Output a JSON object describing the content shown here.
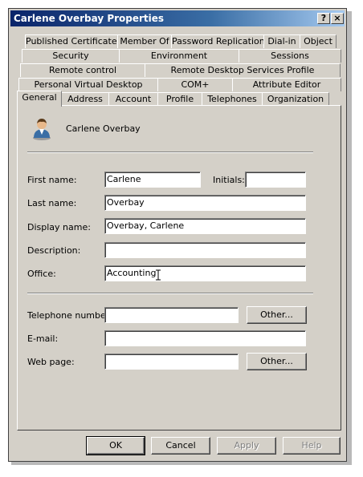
{
  "window": {
    "title": "Carlene Overbay Properties"
  },
  "titlebar": {
    "help_label": "?",
    "close_label": "×"
  },
  "tabs": {
    "row1": [
      "Published Certificates",
      "Member Of",
      "Password Replication",
      "Dial-in",
      "Object"
    ],
    "row2": [
      "Security",
      "Environment",
      "Sessions"
    ],
    "row3": [
      "Remote control",
      "Remote Desktop Services Profile"
    ],
    "row4": [
      "Personal Virtual Desktop",
      "COM+",
      "Attribute Editor"
    ],
    "row5": [
      "General",
      "Address",
      "Account",
      "Profile",
      "Telephones",
      "Organization"
    ]
  },
  "general": {
    "user_name": "Carlene Overbay",
    "first_name_label": "First name:",
    "first_name": "Carlene",
    "initials_label": "Initials:",
    "initials": "",
    "last_name_label": "Last name:",
    "last_name": "Overbay",
    "display_name_label": "Display name:",
    "display_name": "Overbay, Carlene",
    "description_label": "Description:",
    "description": "",
    "office_label": "Office:",
    "office": "Accounting",
    "telephone_label": "Telephone number:",
    "telephone": "",
    "email_label": "E-mail:",
    "email": "",
    "webpage_label": "Web page:",
    "webpage": "",
    "other_label": "Other..."
  },
  "footer": {
    "ok": "OK",
    "cancel": "Cancel",
    "apply": "Apply",
    "help": "Help"
  }
}
